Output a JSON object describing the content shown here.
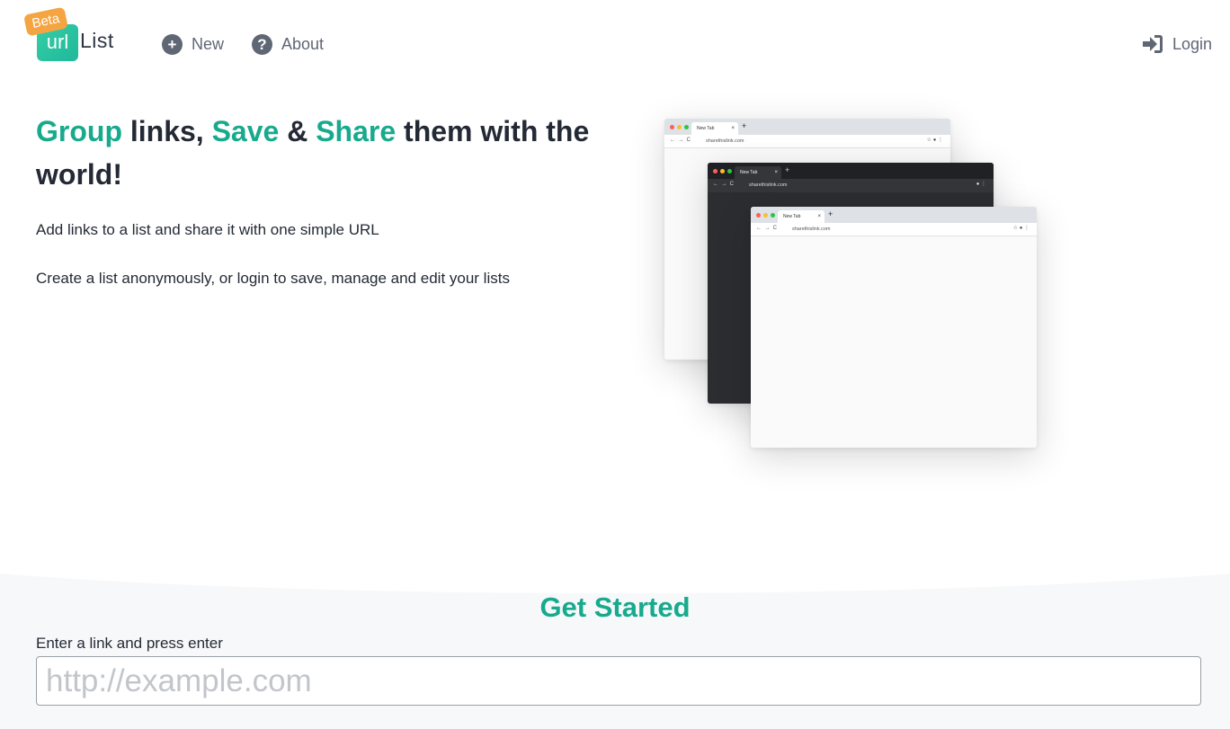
{
  "header": {
    "logo": {
      "badge": "Beta",
      "mark": "url",
      "word": "List"
    },
    "nav": {
      "new_label": "New",
      "about_label": "About",
      "login_label": "Login"
    },
    "icons": {
      "new": "plus-circle-icon",
      "about": "question-circle-icon",
      "login": "sign-in-icon"
    }
  },
  "hero": {
    "title_parts": [
      "Group",
      " links, ",
      "Save",
      " & ",
      "Share",
      " them with the world!"
    ],
    "subtitle1": "Add links to a list and share it with one simple URL",
    "subtitle2": "Create a list anonymously, or login to save, manage and edit your lists"
  },
  "mockup": {
    "tab_title": "New Tab",
    "tab_close": "×",
    "tab_plus": "+",
    "url": "sharethislink.com"
  },
  "get_started": {
    "heading": "Get Started",
    "input_label": "Enter a link and press enter",
    "input_placeholder": "http://example.com",
    "input_value": ""
  },
  "colors": {
    "accent": "#17aa8d",
    "beta_badge": "#f5a442",
    "text": "#242a35",
    "nav_text": "#5f6775"
  }
}
